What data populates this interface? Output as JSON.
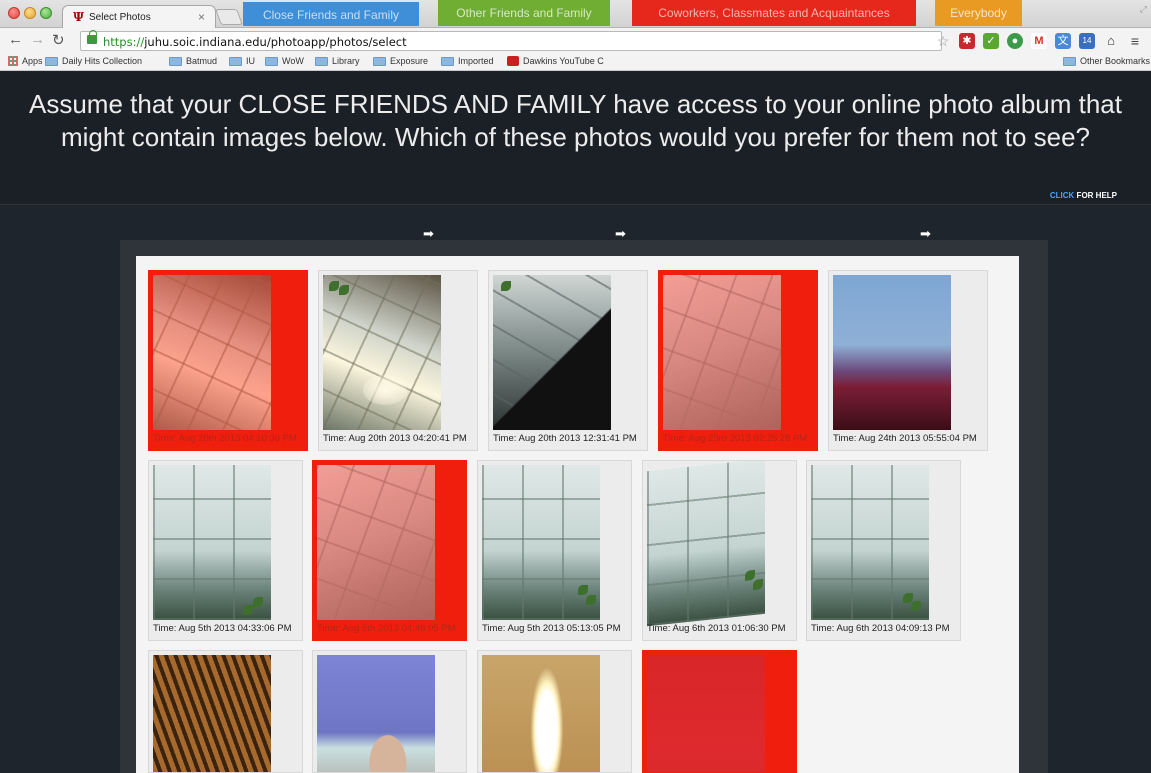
{
  "browser": {
    "tab_title": "Select Photos",
    "tab_favicon": "Ψ",
    "tab_close": "×",
    "url_scheme": "https://",
    "url_rest": "juhu.soic.indiana.edu/photoapp/photos/select",
    "bookmarks": [
      "Apps",
      "Daily Hits Collection",
      "Batmud",
      "IU",
      "WoW",
      "Library",
      "Exposure",
      "Imported",
      "Dawkins YouTube C"
    ],
    "other_bookmarks": "Other Bookmarks"
  },
  "page": {
    "question": "Assume that your CLOSE FRIENDS AND FAMILY have access to your online photo album that might contain images below. Which of these photos would you prefer for them not to see?",
    "help_click": "CLICK",
    "help_rest": " FOR HELP"
  },
  "steps": [
    {
      "label": "Close Friends and Family",
      "color": "#3e8fd8"
    },
    {
      "label": "Other Friends and Family",
      "color": "#6fae32"
    },
    {
      "label": "Coworkers, Classmates and Acquaintances",
      "color": "#e5281b"
    },
    {
      "label": "Everybody",
      "color": "#e99a22"
    }
  ],
  "photos": [
    {
      "caption": "Time: Aug 20th 2013 04:10:30 PM",
      "selected": true
    },
    {
      "caption": "Time: Aug 20th 2013 04:20:41 PM",
      "selected": false
    },
    {
      "caption": "Time: Aug 20th 2013 12:31:41 PM",
      "selected": false
    },
    {
      "caption": "Time: Aug 23rd 2013 02:25:28 PM",
      "selected": true
    },
    {
      "caption": "Time: Aug 24th 2013 05:55:04 PM",
      "selected": false
    },
    {
      "caption": "Time: Aug 5th 2013 04:33:06 PM",
      "selected": false
    },
    {
      "caption": "Time: Aug 5th 2013 04:48:05 PM",
      "selected": true
    },
    {
      "caption": "Time: Aug 5th 2013 05:13:05 PM",
      "selected": false
    },
    {
      "caption": "Time: Aug 6th 2013 01:06:30 PM",
      "selected": false
    },
    {
      "caption": "Time: Aug 6th 2013 04:09:13 PM",
      "selected": false
    },
    {
      "caption": "",
      "selected": false
    },
    {
      "caption": "",
      "selected": false
    },
    {
      "caption": "",
      "selected": false
    },
    {
      "caption": "",
      "selected": true
    }
  ],
  "colors": {
    "selected": "#f01e0c",
    "header_bg": "#1b2027",
    "help_link": "#4aa3ff"
  }
}
